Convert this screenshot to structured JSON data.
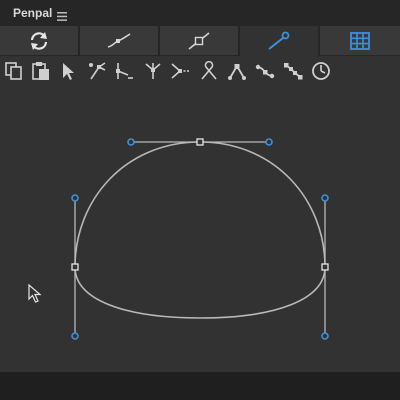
{
  "app": {
    "title": "Penpal"
  },
  "icons": {
    "menu": "hamburger-menu-icon",
    "cursor": "mouse-pointer-icon"
  },
  "tabs": [
    {
      "icon": "refresh-icon",
      "active": false
    },
    {
      "icon": "curve-icon",
      "active": false
    },
    {
      "icon": "straight-segment-icon",
      "active": false
    },
    {
      "icon": "pen-tool-icon",
      "active": true
    },
    {
      "icon": "grid-icon",
      "active": false
    }
  ],
  "toolbar": {
    "tools": [
      "copy-icon",
      "paste-icon",
      "select-arrow-icon",
      "add-point-icon",
      "remove-point-icon",
      "branch-icon",
      "merge-icon",
      "crossing-icon",
      "corner-point-icon",
      "smooth-point-icon",
      "smooth-path-icon",
      "timer-icon"
    ]
  },
  "colors": {
    "accent": "#3d8fe0",
    "curve": "#b8b8b8",
    "handle_point": "#3d8fe0",
    "anchor_point": "#ffffff",
    "background": "#323232",
    "bar": "#262626"
  }
}
